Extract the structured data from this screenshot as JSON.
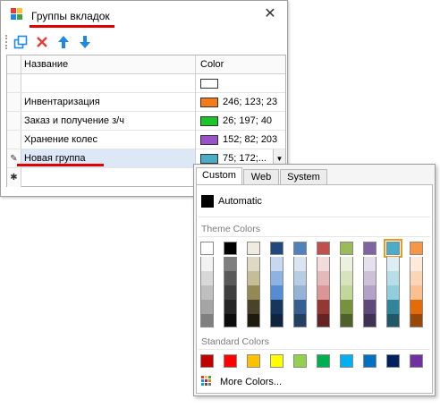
{
  "window": {
    "title": "Группы вкладок",
    "close_glyph": "✕"
  },
  "toolbar": {
    "buttons": [
      {
        "name": "add-group-button",
        "icon": "copy-icon",
        "color": "#1e88e5"
      },
      {
        "name": "delete-button",
        "icon": "delete-x-icon",
        "color": "#e53935"
      },
      {
        "name": "move-up-button",
        "icon": "arrow-up-icon",
        "color": "#1e88e5"
      },
      {
        "name": "move-down-button",
        "icon": "arrow-down-icon",
        "color": "#1e88e5"
      }
    ]
  },
  "grid": {
    "columns": {
      "name": "Название",
      "color": "Color"
    },
    "rows": [
      {
        "name": "",
        "color_text": "",
        "swatch": "#ffffff"
      },
      {
        "name": "Инвентаризация",
        "color_text": "246; 123; 23",
        "swatch": "#f67b17"
      },
      {
        "name": "Заказ и получение з/ч",
        "color_text": "26; 197; 40",
        "swatch": "#1ac528"
      },
      {
        "name": "Хранение колес",
        "color_text": "152; 82; 203",
        "swatch": "#9852cb"
      },
      {
        "name": "Новая группа",
        "color_text": "75; 172;...",
        "swatch": "#4bacc6"
      }
    ],
    "edit_marker": "✎",
    "new_row_marker": "✱",
    "dropdown_arrow": "▼"
  },
  "color_picker": {
    "tabs": [
      "Custom",
      "Web",
      "System"
    ],
    "active_tab": "Custom",
    "automatic_label": "Automatic",
    "automatic_color": "#000000",
    "theme_colors_label": "Theme Colors",
    "theme_colors": [
      [
        "#ffffff",
        "#000000",
        "#eeece1",
        "#1f497d",
        "#4f81bd",
        "#c0504d",
        "#9bbb59",
        "#8064a2",
        "#4bacc6",
        "#f79646"
      ],
      [
        "#f2f2f2",
        "#7f7f7f",
        "#ddd9c3",
        "#c6d9f0",
        "#dbe5f1",
        "#f2dcdb",
        "#ebf1dd",
        "#e5e0ec",
        "#dbeef3",
        "#fdeada"
      ],
      [
        "#d8d8d8",
        "#595959",
        "#c4bd97",
        "#8db3e2",
        "#b8cce4",
        "#e5b9b7",
        "#d7e3bc",
        "#ccc1d9",
        "#b7dde8",
        "#fbd5b5"
      ],
      [
        "#bfbfbf",
        "#3f3f3f",
        "#938953",
        "#548dd4",
        "#95b3d7",
        "#d99694",
        "#c3d69b",
        "#b2a2c7",
        "#92cddc",
        "#fac08f"
      ],
      [
        "#a5a5a5",
        "#262626",
        "#494429",
        "#17365d",
        "#366092",
        "#953734",
        "#76923c",
        "#5f497a",
        "#31859b",
        "#e36c09"
      ],
      [
        "#7f7f7f",
        "#0c0c0c",
        "#1d1b10",
        "#0f243e",
        "#244061",
        "#632423",
        "#4f6128",
        "#3f3151",
        "#205867",
        "#974806"
      ]
    ],
    "selected_theme_color": "#4bacc6",
    "standard_colors_label": "Standard Colors",
    "standard_colors": [
      "#c00000",
      "#ff0000",
      "#ffc000",
      "#ffff00",
      "#92d050",
      "#00b050",
      "#00b0f0",
      "#0070c0",
      "#002060",
      "#7030a0"
    ],
    "more_colors_label": "More Colors..."
  },
  "annotation_color": "#e00000"
}
